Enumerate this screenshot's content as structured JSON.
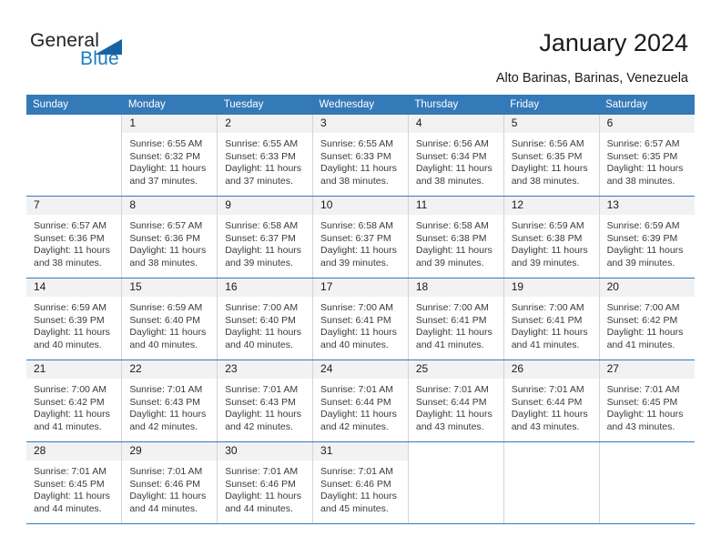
{
  "brand": {
    "name_part1": "General",
    "name_part2": "Blue"
  },
  "header": {
    "title": "January 2024",
    "subtitle": "Alto Barinas, Barinas, Venezuela"
  },
  "calendar": {
    "weekday_headers": [
      "Sunday",
      "Monday",
      "Tuesday",
      "Wednesday",
      "Thursday",
      "Friday",
      "Saturday"
    ],
    "colors": {
      "header_bg": "#3479b8",
      "daynum_bg": "#f2f2f2",
      "row_rule": "#3479b8",
      "col_rule": "#d4d4d4",
      "brand_blue": "#1f7bc1"
    },
    "weeks": [
      [
        {
          "day": "",
          "blank": true,
          "sunrise": "",
          "sunset": "",
          "daylight1": "",
          "daylight2": ""
        },
        {
          "day": "1",
          "sunrise": "Sunrise: 6:55 AM",
          "sunset": "Sunset: 6:32 PM",
          "daylight1": "Daylight: 11 hours",
          "daylight2": "and 37 minutes."
        },
        {
          "day": "2",
          "sunrise": "Sunrise: 6:55 AM",
          "sunset": "Sunset: 6:33 PM",
          "daylight1": "Daylight: 11 hours",
          "daylight2": "and 37 minutes."
        },
        {
          "day": "3",
          "sunrise": "Sunrise: 6:55 AM",
          "sunset": "Sunset: 6:33 PM",
          "daylight1": "Daylight: 11 hours",
          "daylight2": "and 38 minutes."
        },
        {
          "day": "4",
          "sunrise": "Sunrise: 6:56 AM",
          "sunset": "Sunset: 6:34 PM",
          "daylight1": "Daylight: 11 hours",
          "daylight2": "and 38 minutes."
        },
        {
          "day": "5",
          "sunrise": "Sunrise: 6:56 AM",
          "sunset": "Sunset: 6:35 PM",
          "daylight1": "Daylight: 11 hours",
          "daylight2": "and 38 minutes."
        },
        {
          "day": "6",
          "sunrise": "Sunrise: 6:57 AM",
          "sunset": "Sunset: 6:35 PM",
          "daylight1": "Daylight: 11 hours",
          "daylight2": "and 38 minutes."
        }
      ],
      [
        {
          "day": "7",
          "sunrise": "Sunrise: 6:57 AM",
          "sunset": "Sunset: 6:36 PM",
          "daylight1": "Daylight: 11 hours",
          "daylight2": "and 38 minutes."
        },
        {
          "day": "8",
          "sunrise": "Sunrise: 6:57 AM",
          "sunset": "Sunset: 6:36 PM",
          "daylight1": "Daylight: 11 hours",
          "daylight2": "and 38 minutes."
        },
        {
          "day": "9",
          "sunrise": "Sunrise: 6:58 AM",
          "sunset": "Sunset: 6:37 PM",
          "daylight1": "Daylight: 11 hours",
          "daylight2": "and 39 minutes."
        },
        {
          "day": "10",
          "sunrise": "Sunrise: 6:58 AM",
          "sunset": "Sunset: 6:37 PM",
          "daylight1": "Daylight: 11 hours",
          "daylight2": "and 39 minutes."
        },
        {
          "day": "11",
          "sunrise": "Sunrise: 6:58 AM",
          "sunset": "Sunset: 6:38 PM",
          "daylight1": "Daylight: 11 hours",
          "daylight2": "and 39 minutes."
        },
        {
          "day": "12",
          "sunrise": "Sunrise: 6:59 AM",
          "sunset": "Sunset: 6:38 PM",
          "daylight1": "Daylight: 11 hours",
          "daylight2": "and 39 minutes."
        },
        {
          "day": "13",
          "sunrise": "Sunrise: 6:59 AM",
          "sunset": "Sunset: 6:39 PM",
          "daylight1": "Daylight: 11 hours",
          "daylight2": "and 39 minutes."
        }
      ],
      [
        {
          "day": "14",
          "sunrise": "Sunrise: 6:59 AM",
          "sunset": "Sunset: 6:39 PM",
          "daylight1": "Daylight: 11 hours",
          "daylight2": "and 40 minutes."
        },
        {
          "day": "15",
          "sunrise": "Sunrise: 6:59 AM",
          "sunset": "Sunset: 6:40 PM",
          "daylight1": "Daylight: 11 hours",
          "daylight2": "and 40 minutes."
        },
        {
          "day": "16",
          "sunrise": "Sunrise: 7:00 AM",
          "sunset": "Sunset: 6:40 PM",
          "daylight1": "Daylight: 11 hours",
          "daylight2": "and 40 minutes."
        },
        {
          "day": "17",
          "sunrise": "Sunrise: 7:00 AM",
          "sunset": "Sunset: 6:41 PM",
          "daylight1": "Daylight: 11 hours",
          "daylight2": "and 40 minutes."
        },
        {
          "day": "18",
          "sunrise": "Sunrise: 7:00 AM",
          "sunset": "Sunset: 6:41 PM",
          "daylight1": "Daylight: 11 hours",
          "daylight2": "and 41 minutes."
        },
        {
          "day": "19",
          "sunrise": "Sunrise: 7:00 AM",
          "sunset": "Sunset: 6:41 PM",
          "daylight1": "Daylight: 11 hours",
          "daylight2": "and 41 minutes."
        },
        {
          "day": "20",
          "sunrise": "Sunrise: 7:00 AM",
          "sunset": "Sunset: 6:42 PM",
          "daylight1": "Daylight: 11 hours",
          "daylight2": "and 41 minutes."
        }
      ],
      [
        {
          "day": "21",
          "sunrise": "Sunrise: 7:00 AM",
          "sunset": "Sunset: 6:42 PM",
          "daylight1": "Daylight: 11 hours",
          "daylight2": "and 41 minutes."
        },
        {
          "day": "22",
          "sunrise": "Sunrise: 7:01 AM",
          "sunset": "Sunset: 6:43 PM",
          "daylight1": "Daylight: 11 hours",
          "daylight2": "and 42 minutes."
        },
        {
          "day": "23",
          "sunrise": "Sunrise: 7:01 AM",
          "sunset": "Sunset: 6:43 PM",
          "daylight1": "Daylight: 11 hours",
          "daylight2": "and 42 minutes."
        },
        {
          "day": "24",
          "sunrise": "Sunrise: 7:01 AM",
          "sunset": "Sunset: 6:44 PM",
          "daylight1": "Daylight: 11 hours",
          "daylight2": "and 42 minutes."
        },
        {
          "day": "25",
          "sunrise": "Sunrise: 7:01 AM",
          "sunset": "Sunset: 6:44 PM",
          "daylight1": "Daylight: 11 hours",
          "daylight2": "and 43 minutes."
        },
        {
          "day": "26",
          "sunrise": "Sunrise: 7:01 AM",
          "sunset": "Sunset: 6:44 PM",
          "daylight1": "Daylight: 11 hours",
          "daylight2": "and 43 minutes."
        },
        {
          "day": "27",
          "sunrise": "Sunrise: 7:01 AM",
          "sunset": "Sunset: 6:45 PM",
          "daylight1": "Daylight: 11 hours",
          "daylight2": "and 43 minutes."
        }
      ],
      [
        {
          "day": "28",
          "sunrise": "Sunrise: 7:01 AM",
          "sunset": "Sunset: 6:45 PM",
          "daylight1": "Daylight: 11 hours",
          "daylight2": "and 44 minutes."
        },
        {
          "day": "29",
          "sunrise": "Sunrise: 7:01 AM",
          "sunset": "Sunset: 6:46 PM",
          "daylight1": "Daylight: 11 hours",
          "daylight2": "and 44 minutes."
        },
        {
          "day": "30",
          "sunrise": "Sunrise: 7:01 AM",
          "sunset": "Sunset: 6:46 PM",
          "daylight1": "Daylight: 11 hours",
          "daylight2": "and 44 minutes."
        },
        {
          "day": "31",
          "sunrise": "Sunrise: 7:01 AM",
          "sunset": "Sunset: 6:46 PM",
          "daylight1": "Daylight: 11 hours",
          "daylight2": "and 45 minutes."
        },
        {
          "day": "",
          "blank": true,
          "sunrise": "",
          "sunset": "",
          "daylight1": "",
          "daylight2": ""
        },
        {
          "day": "",
          "blank": true,
          "sunrise": "",
          "sunset": "",
          "daylight1": "",
          "daylight2": ""
        },
        {
          "day": "",
          "blank": true,
          "sunrise": "",
          "sunset": "",
          "daylight1": "",
          "daylight2": ""
        }
      ]
    ]
  }
}
